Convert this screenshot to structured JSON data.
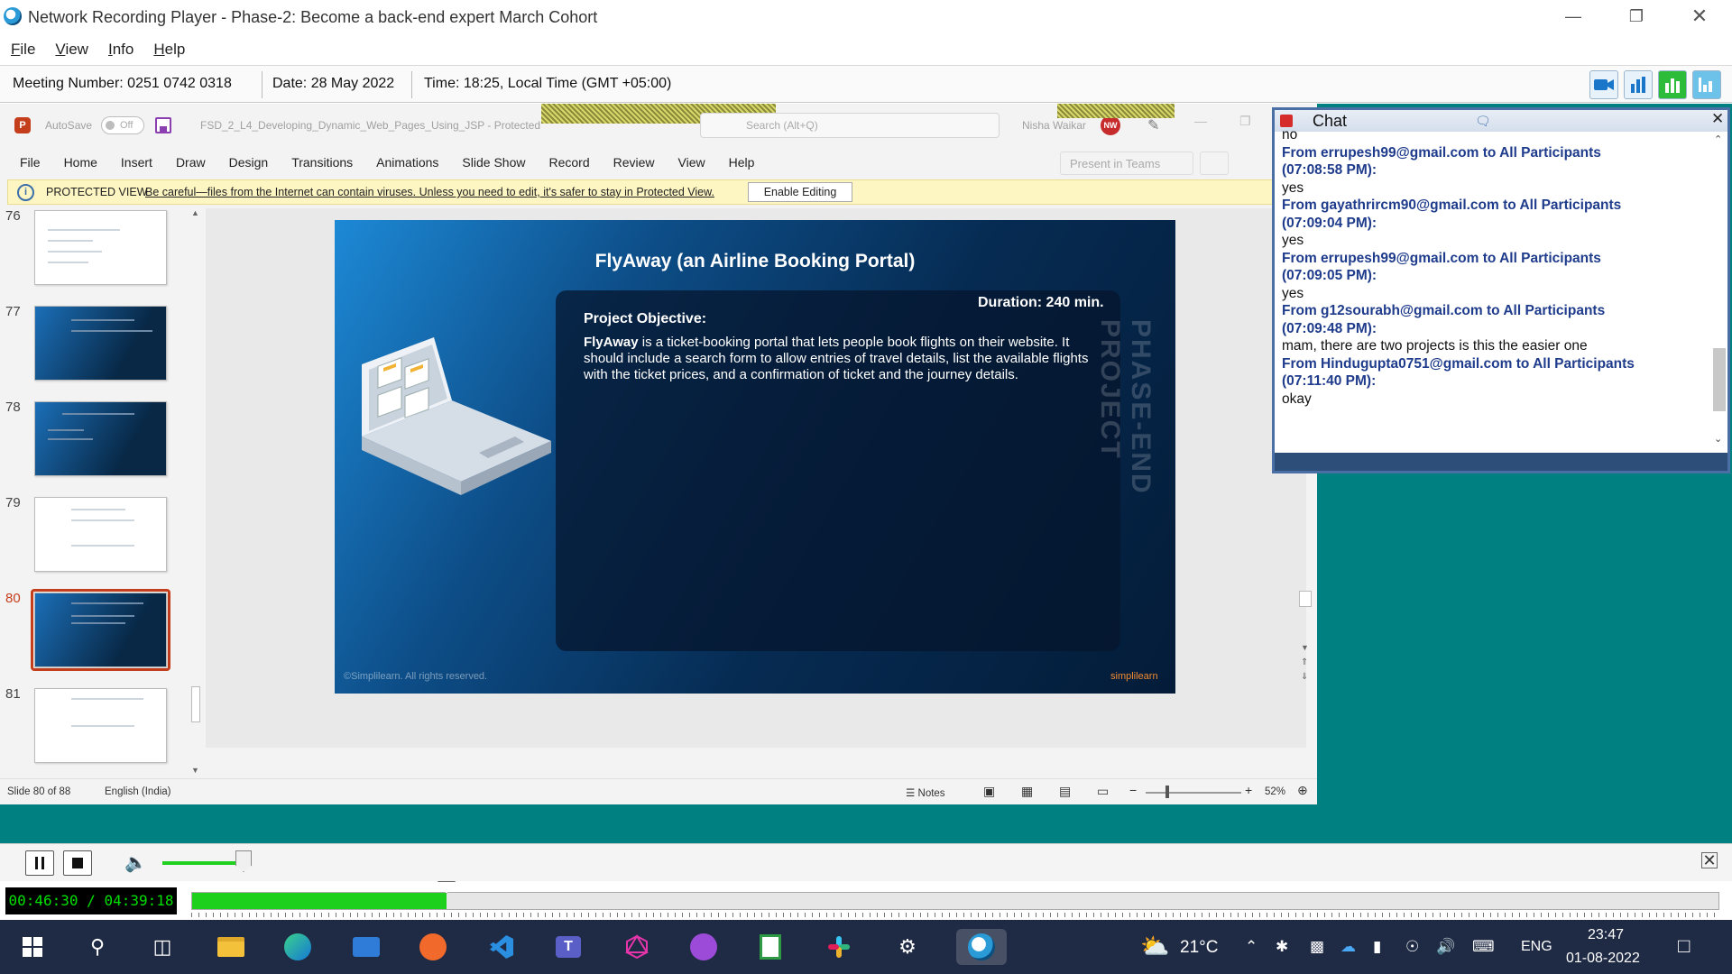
{
  "window": {
    "title": "Network Recording Player - Phase-2: Become a back-end expert March Cohort"
  },
  "menu": [
    "File",
    "View",
    "Info",
    "Help"
  ],
  "info_bar": {
    "meeting": "Meeting Number: 0251 0742 0318",
    "date": "Date: 28 May 2022",
    "time": "Time: 18:25, Local Time (GMT +05:00)"
  },
  "ppt": {
    "autosave_label": "AutoSave",
    "autosave_state": "Off",
    "filename": "FSD_2_L4_Developing_Dynamic_Web_Pages_Using_JSP  -  Protected",
    "search_placeholder": "Search (Alt+Q)",
    "user_name": "Nisha Waikar",
    "user_initials": "NW",
    "tabs": [
      "File",
      "Home",
      "Insert",
      "Draw",
      "Design",
      "Transitions",
      "Animations",
      "Slide Show",
      "Record",
      "Review",
      "View",
      "Help"
    ],
    "present_teams": "Present in Teams",
    "protected_label": "PROTECTED VIEW",
    "protected_msg": "Be careful—files from the Internet can contain viruses. Unless you need to edit, it's safer to stay in Protected View.",
    "enable_editing": "Enable Editing",
    "thumbnails": [
      {
        "num": "76",
        "style": "white"
      },
      {
        "num": "77",
        "style": "blue"
      },
      {
        "num": "78",
        "style": "blue"
      },
      {
        "num": "79",
        "style": "white"
      },
      {
        "num": "80",
        "style": "blue",
        "selected": true
      },
      {
        "num": "81",
        "style": "white"
      }
    ],
    "slide": {
      "title": "FlyAway (an Airline Booking Portal)",
      "duration": "Duration: 240 min.",
      "objective_heading": "Project Objective:",
      "body_bold": "FlyAway",
      "body_text": " is a ticket-booking portal that lets people book flights on their website. It should include a search form to allow entries of travel details, list the available flights with the ticket prices, and a confirmation of ticket and the journey details.",
      "vertical_label": "PHASE-END PROJECT",
      "copyright": "©Simplilearn. All rights reserved.",
      "brand": "simplilearn"
    },
    "status": {
      "slide_count": "Slide 80 of 88",
      "language": "English (India)",
      "notes": "Notes",
      "zoom": "52%"
    }
  },
  "chat": {
    "title": "Chat",
    "messages": [
      {
        "text": "no"
      },
      {
        "from": "From errupesh99@gmail.com  to All Participants",
        "time": "(07:08:58 PM):",
        "text": "yes"
      },
      {
        "from": "From gayathrircm90@gmail.com to All Participants",
        "time": "(07:09:04 PM):",
        "text": "yes"
      },
      {
        "from": "From errupesh99@gmail.com  to All Participants",
        "time": "(07:09:05 PM):",
        "text": "yes"
      },
      {
        "from": "From g12sourabh@gmail.com to All Participants",
        "time": "(07:09:48 PM):",
        "text": "mam, there are two projects is this the easier one"
      },
      {
        "from": "From Hindugupta0751@gmail.com to All Participants",
        "time": "(07:11:40 PM):",
        "text": "okay"
      }
    ]
  },
  "player": {
    "time_display": "00:46:30 / 04:39:18",
    "progress": 0.1664,
    "volume": 0.85
  },
  "taskbar": {
    "weather": "21°C",
    "lang": "ENG",
    "clock_time": "23:47",
    "clock_date": "01-08-2022",
    "apps": [
      "start-icon",
      "search-icon",
      "task-view-icon",
      "file-explorer-icon",
      "edge-icon",
      "mail-icon",
      "pencil-app-icon",
      "vscode-icon",
      "teams-icon",
      "graphql-icon",
      "github-icon",
      "notepad-icon",
      "slack-icon",
      "settings-app-icon",
      "recording-player-icon"
    ]
  },
  "colors": {
    "teal_bg": "#008080",
    "progress_green": "#1ed01e",
    "ppt_accent": "#c43e1c",
    "chat_from": "#1f3c8c"
  }
}
